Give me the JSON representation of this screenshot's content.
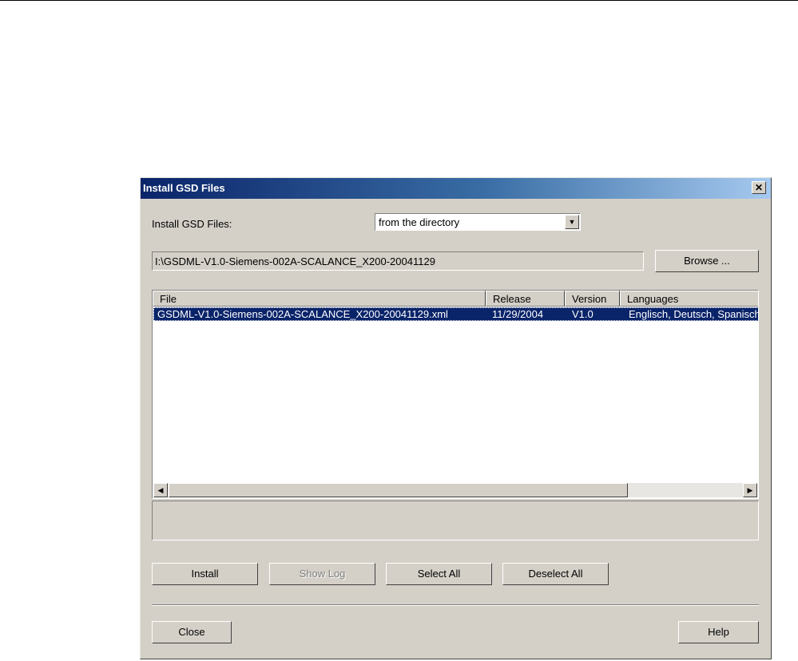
{
  "window": {
    "title": "Install GSD Files"
  },
  "source": {
    "label": "Install GSD Files:",
    "selected": "from the directory",
    "path": "I:\\GSDML-V1.0-Siemens-002A-SCALANCE_X200-20041129",
    "browse_label": "Browse ..."
  },
  "table": {
    "columns": [
      "File",
      "Release",
      "Version",
      "Languages"
    ],
    "rows": [
      {
        "file": "GSDML-V1.0-Siemens-002A-SCALANCE_X200-20041129.xml",
        "release": "11/29/2004",
        "version": "V1.0",
        "languages": "Englisch, Deutsch, Spanisch"
      }
    ]
  },
  "actions": {
    "install": "Install",
    "show_log": "Show Log",
    "select_all": "Select All",
    "deselect_all": "Deselect All"
  },
  "footer": {
    "close": "Close",
    "help": "Help"
  },
  "colors": {
    "dialog_bg": "#d4d0c8",
    "title_dark": "#0a246a",
    "selection": "#0a246a"
  }
}
